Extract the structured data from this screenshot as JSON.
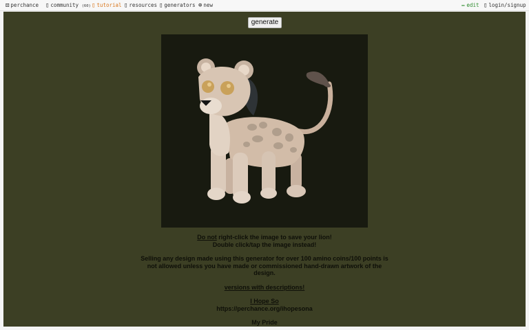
{
  "nav": {
    "brand": "perchance",
    "community": "community",
    "community_count": "(60)",
    "tutorial": "tutorial",
    "resources": "resources",
    "generators": "generators",
    "new": "new",
    "edit": "edit",
    "login": "login/signup"
  },
  "main": {
    "generate_label": "generate",
    "image_alt": "lion",
    "warning_strong": "Do not",
    "warning_rest": " right-click the image to save your lion!",
    "warning_line2": "Double click/tap the image instead!",
    "selling_note": "Selling any design made using this generator for over 100 amino coins/100 points is not allowed unless you have made or commissioned hand-drawn artwork of the design.",
    "versions_link": "versions with descriptions!",
    "link1_title": "I Hope So",
    "link1_url": "https://perchance.org/ihopesona",
    "link2_title": "My Pride"
  },
  "colors": {
    "page_bg": "#3c3f24",
    "frame_bg": "#181a10",
    "tutorial": "#d9781f",
    "edit": "#2b8a2b"
  }
}
